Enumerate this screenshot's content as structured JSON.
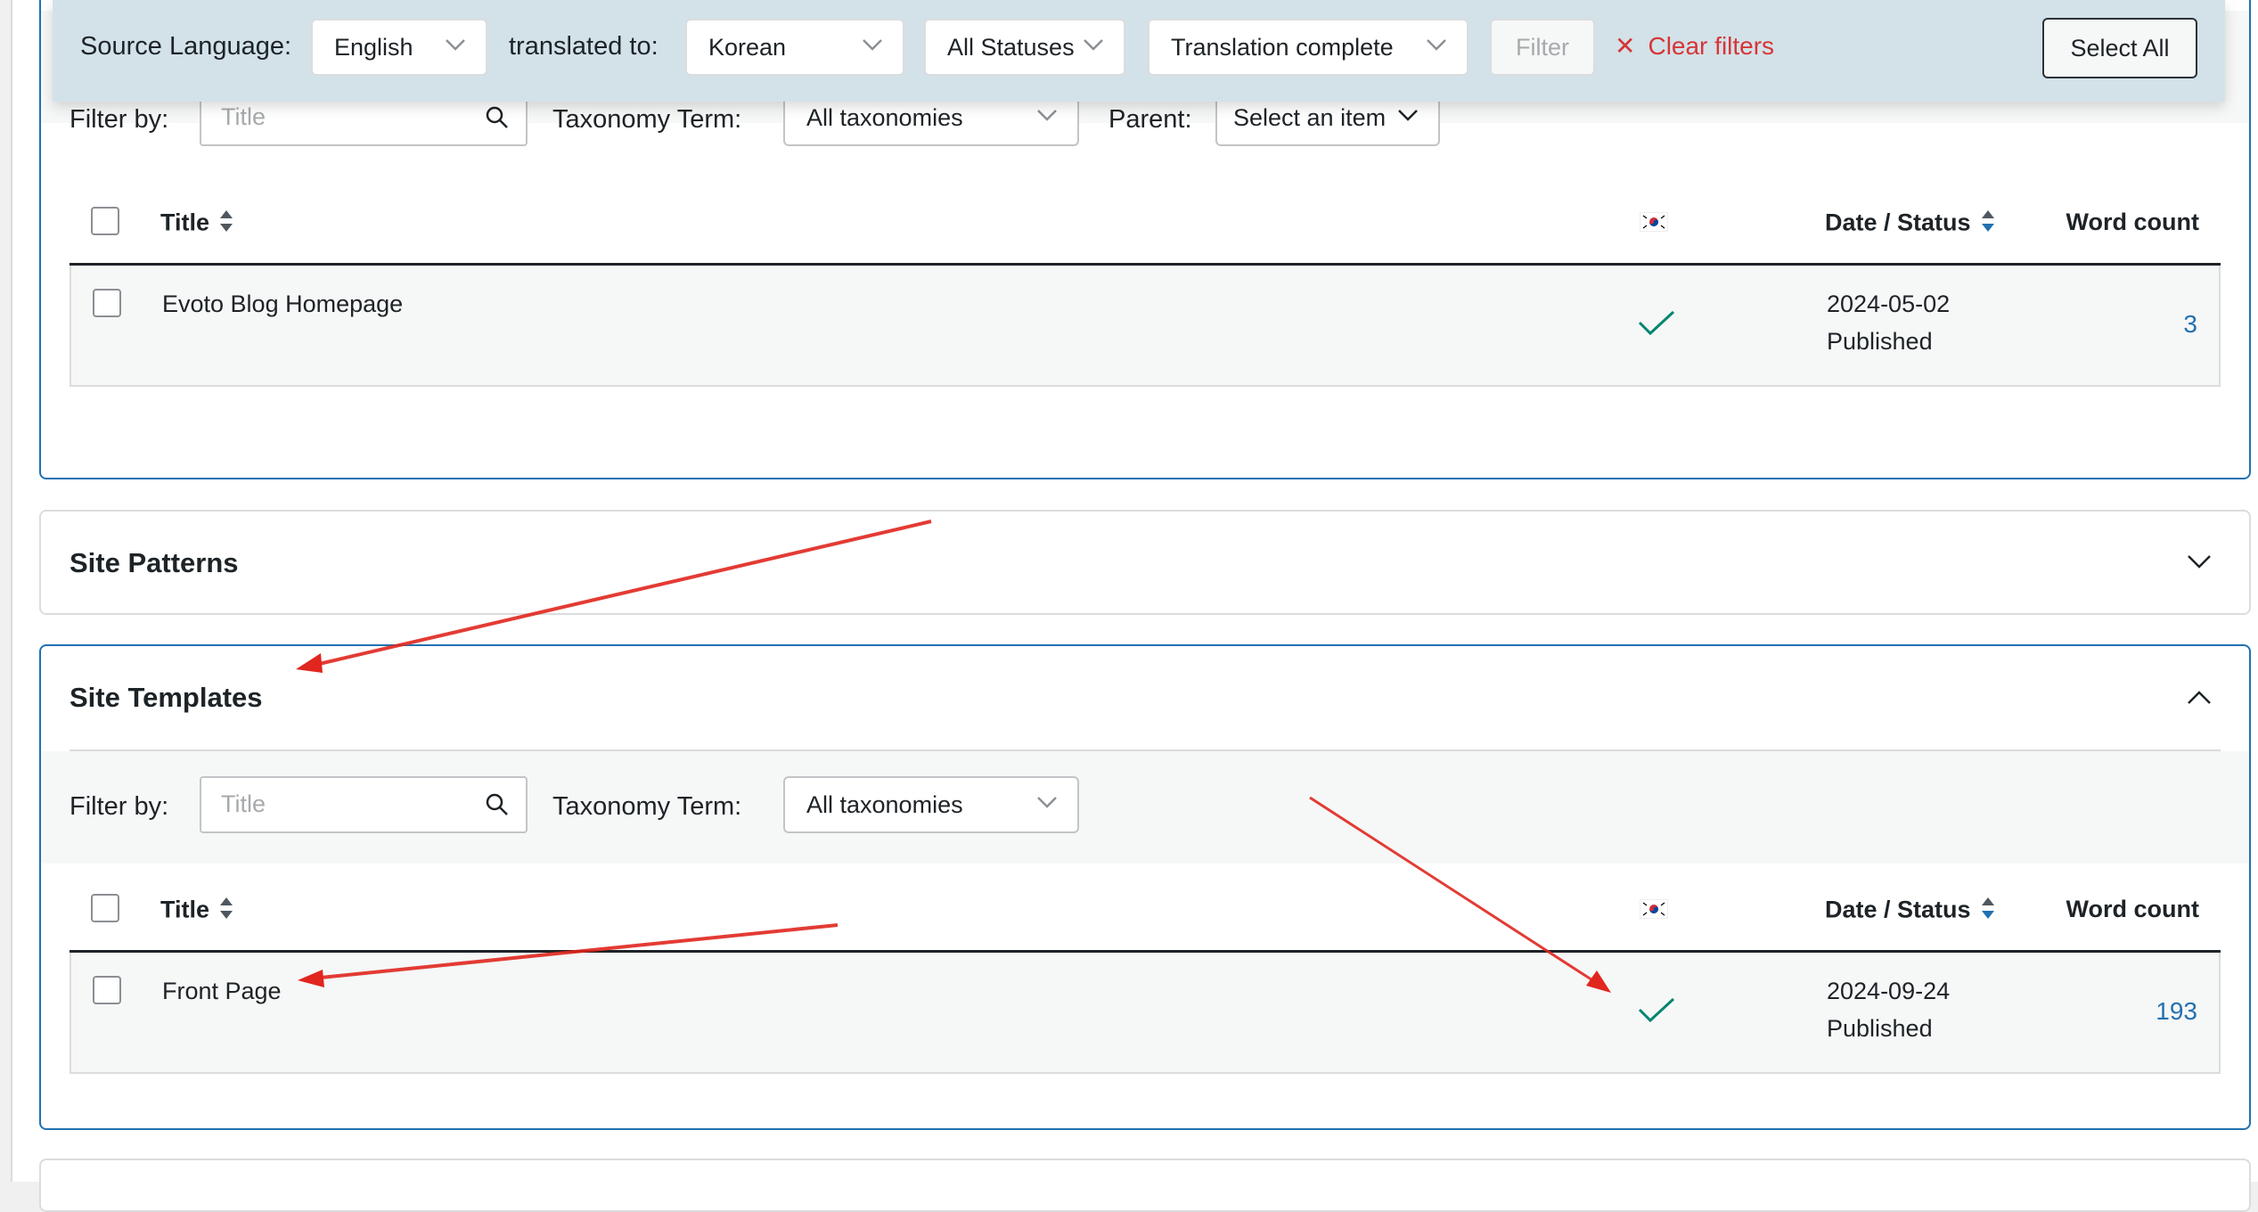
{
  "topbar": {
    "source_label": "Source Language:",
    "source_value": "English",
    "translated_label": "translated to:",
    "target_value": "Korean",
    "status_value": "All Statuses",
    "translation_value": "Translation complete",
    "filter_label": "Filter",
    "clear_label": "Clear filters",
    "select_all_label": "Select All"
  },
  "top_panel": {
    "filter_by_label": "Filter by:",
    "search_placeholder": "Title",
    "taxonomy_label": "Taxonomy Term:",
    "taxonomy_value": "All taxonomies",
    "parent_label": "Parent:",
    "parent_value": "Select an item",
    "columns": {
      "title": "Title",
      "date_status": "Date / Status",
      "word_count": "Word count"
    },
    "rows": [
      {
        "title": "Evoto Blog Homepage",
        "date": "2024-05-02",
        "status": "Published",
        "word_count": "3"
      }
    ]
  },
  "patterns_panel": {
    "title": "Site Patterns"
  },
  "templates_panel": {
    "title": "Site Templates",
    "filter_by_label": "Filter by:",
    "search_placeholder": "Title",
    "taxonomy_label": "Taxonomy Term:",
    "taxonomy_value": "All taxonomies",
    "columns": {
      "title": "Title",
      "date_status": "Date / Status",
      "word_count": "Word count"
    },
    "rows": [
      {
        "title": "Front Page",
        "date": "2024-09-24",
        "status": "Published",
        "word_count": "193"
      }
    ]
  },
  "colors": {
    "accent": "#2271b1",
    "danger": "#d63638",
    "topbar_bg": "#d3e2e8",
    "annotation": "#e0261e",
    "check": "#00856f"
  }
}
